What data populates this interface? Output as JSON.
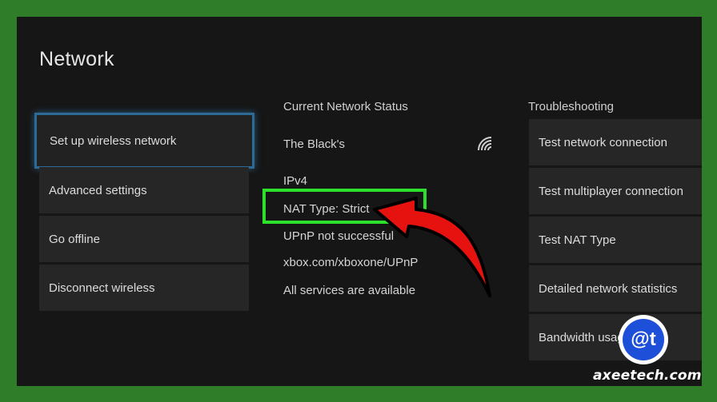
{
  "page": {
    "title": "Network"
  },
  "menu": {
    "items": [
      {
        "label": "Set up wireless network"
      },
      {
        "label": "Advanced settings"
      },
      {
        "label": "Go offline"
      },
      {
        "label": "Disconnect wireless"
      }
    ]
  },
  "status": {
    "heading": "Current Network Status",
    "network_name": "The Black's",
    "ip_version": "IPv4",
    "nat_type": "NAT Type: Strict",
    "upnp": "UPnP not successful",
    "upnp_link": "xbox.com/xboxone/UPnP",
    "services": "All services are available"
  },
  "troubleshooting": {
    "heading": "Troubleshooting",
    "items": [
      {
        "label": "Test network connection"
      },
      {
        "label": "Test multiplayer connection"
      },
      {
        "label": "Test NAT Type"
      },
      {
        "label": "Detailed network statistics"
      },
      {
        "label": "Bandwidth usage"
      }
    ]
  },
  "watermark": {
    "site": "axeetech.com",
    "logo_text": "@t"
  },
  "colors": {
    "focus": "#2d6b96",
    "highlight": "#2ce02c",
    "arrow": "#e5120f",
    "frame": "#2f7d28"
  },
  "icons": {
    "wifi": "wifi-signal-icon"
  }
}
